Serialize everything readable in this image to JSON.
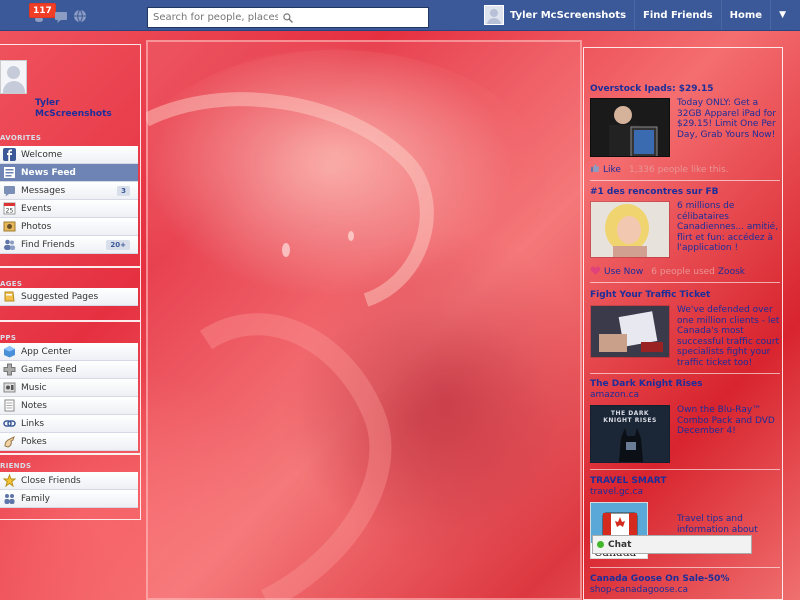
{
  "topbar": {
    "notification_count": "117",
    "search_placeholder": "Search for people, places a",
    "user_name": "Tyler McScreenshots",
    "find_friends": "Find Friends",
    "home": "Home",
    "caret": "▼"
  },
  "profile": {
    "name": "Tyler McScreenshots"
  },
  "favorites": {
    "title": "AVORITES",
    "items": [
      {
        "label": "Welcome",
        "icon": "facebook-icon"
      },
      {
        "label": "News Feed",
        "icon": "news-feed-icon"
      },
      {
        "label": "Messages",
        "icon": "messages-icon",
        "count": "3"
      },
      {
        "label": "Events",
        "icon": "events-icon"
      },
      {
        "label": "Photos",
        "icon": "photos-icon"
      },
      {
        "label": "Find Friends",
        "icon": "friends-icon",
        "count": "20+"
      }
    ]
  },
  "pages": {
    "title": "AGES",
    "items": [
      {
        "label": "Suggested Pages",
        "icon": "pages-icon"
      }
    ]
  },
  "apps": {
    "title": "PPS",
    "items": [
      {
        "label": "App Center",
        "icon": "app-center-icon"
      },
      {
        "label": "Games Feed",
        "icon": "games-icon"
      },
      {
        "label": "Music",
        "icon": "music-icon"
      },
      {
        "label": "Notes",
        "icon": "notes-icon"
      },
      {
        "label": "Links",
        "icon": "links-icon"
      },
      {
        "label": "Pokes",
        "icon": "pokes-icon"
      }
    ]
  },
  "friends": {
    "title": "RIENDS",
    "items": [
      {
        "label": "Close Friends",
        "icon": "star-icon"
      },
      {
        "label": "Family",
        "icon": "family-icon"
      }
    ]
  },
  "ads": [
    {
      "title": "Overstock Ipads: $29.15",
      "text": "Today ONLY: Get a 32GB Apparel iPad for $29.15! Limit One Per Day, Grab Yours Now!",
      "action": "Like",
      "social": "1,336 people like this."
    },
    {
      "title": "#1 des rencontres sur FB",
      "text": "6 millions de célibataires Canadiennes... amitié, flirt et fun: accédez à l'application !",
      "action": "Use Now",
      "social": "6 people used",
      "brand": "Zoosk"
    },
    {
      "title": "Fight Your Traffic Ticket",
      "text": "We've defended over one million clients - let Canada's most successful traffic court specialists fight your traffic ticket too!"
    },
    {
      "title": "The Dark Knight Rises",
      "sub": "amazon.ca",
      "text": "Own the Blu-Ray™ Combo Pack and DVD December 4!",
      "img_text": "THE DARK KNIGHT RISES"
    },
    {
      "title": "TRAVEL SMART",
      "sub": "travel.gc.ca",
      "text": "Travel tips and information about health, laws and",
      "img_text": "Canada"
    },
    {
      "title": "Canada Goose On Sale-50%",
      "sub": "shop-canadagoose.ca"
    }
  ],
  "chat": {
    "label": "Chat"
  },
  "colors": {
    "bar": "#3b5998",
    "link": "#1c2e9a",
    "badge": "#f03d25",
    "background": "#e53040"
  }
}
